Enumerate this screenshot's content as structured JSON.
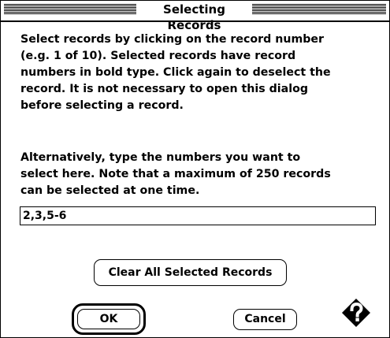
{
  "window": {
    "title": "Selecting Records"
  },
  "instructions": {
    "paragraph1": "Select records by clicking on the record number\n(e.g. 1 of 10). Selected records have record\nnumbers in bold type. Click again to deselect the\nrecord. It is not necessary to open this dialog\nbefore selecting a record.",
    "paragraph2": "Alternatively, type the numbers you want to\nselect here. Note that a maximum of 250 records\ncan be selected at one time."
  },
  "record_field": {
    "value": "2,3,5-6"
  },
  "buttons": {
    "clear": "Clear All Selected Records",
    "ok": "OK",
    "cancel": "Cancel"
  },
  "icons": {
    "help": "help-icon"
  }
}
